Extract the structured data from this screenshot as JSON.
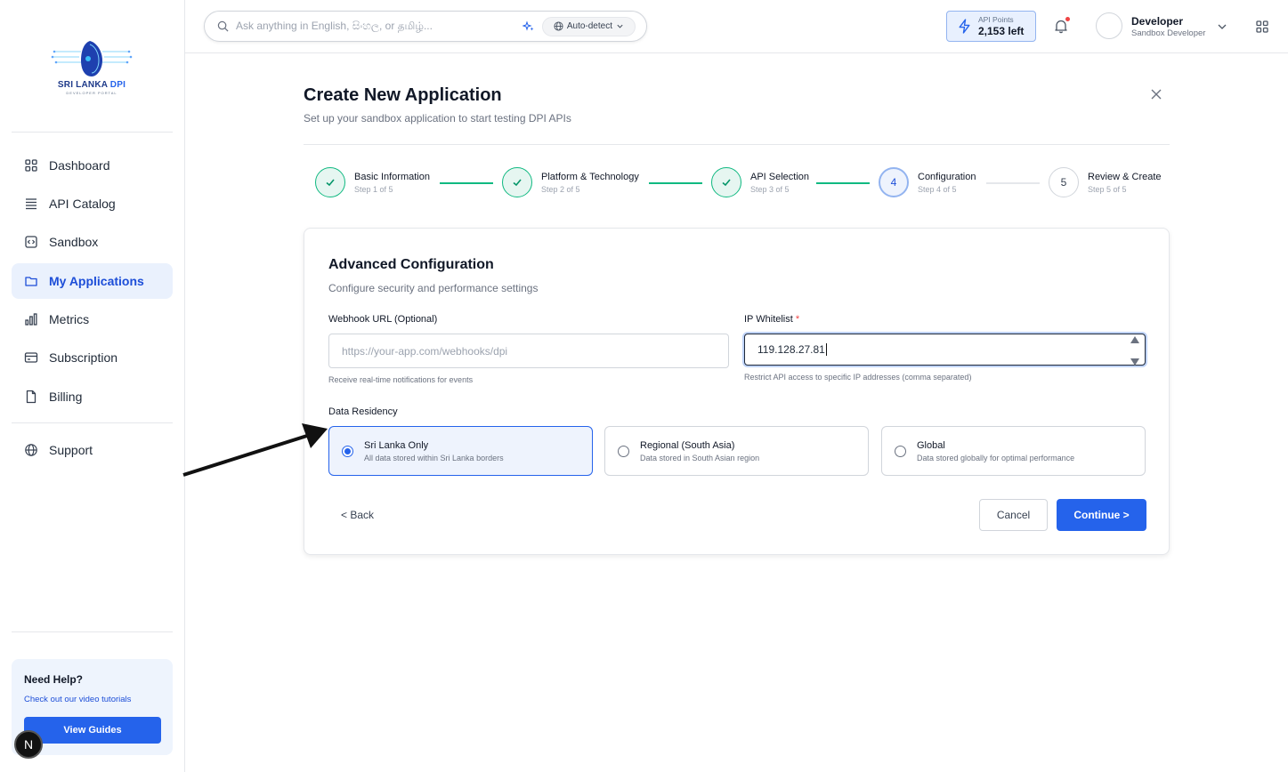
{
  "sidebar": {
    "logo": {
      "line1": "SRI LANKA ",
      "line1_accent": "DPI",
      "line2": "DEVELOPER PORTAL"
    },
    "nav": [
      {
        "label": "Dashboard",
        "icon": "grid-icon"
      },
      {
        "label": "API Catalog",
        "icon": "list-icon"
      },
      {
        "label": "Sandbox",
        "icon": "code-icon"
      },
      {
        "label": "My Applications",
        "icon": "folder-icon",
        "active": true
      },
      {
        "label": "Metrics",
        "icon": "bar-chart-icon"
      },
      {
        "label": "Subscription",
        "icon": "credit-card-icon"
      },
      {
        "label": "Billing",
        "icon": "file-icon"
      },
      {
        "label": "Support",
        "icon": "globe-icon"
      }
    ],
    "help": {
      "title": "Need Help?",
      "subtitle": "Check out our video tutorials",
      "button": "View Guides"
    },
    "badge": "N"
  },
  "topbar": {
    "search_placeholder": "Ask anything in English, සිංහල, or தமிழ்...",
    "language": "Auto-detect",
    "points_label": "API Points",
    "points_value": "2,153 left",
    "user_name": "Developer",
    "user_role": "Sandbox Developer"
  },
  "header": {
    "title": "Create New Application",
    "subtitle": "Set up your sandbox application to start testing DPI APIs"
  },
  "steps": [
    {
      "label": "Basic Information",
      "sub": "Step 1 of 5",
      "state": "done",
      "number": "1"
    },
    {
      "label": "Platform & Technology",
      "sub": "Step 2 of 5",
      "state": "done",
      "number": "2"
    },
    {
      "label": "API Selection",
      "sub": "Step 3 of 5",
      "state": "done",
      "number": "3"
    },
    {
      "label": "Configuration",
      "sub": "Step 4 of 5",
      "state": "current",
      "number": "4"
    },
    {
      "label": "Review & Create",
      "sub": "Step 5 of 5",
      "state": "todo",
      "number": "5"
    }
  ],
  "form": {
    "title": "Advanced Configuration",
    "subtitle": "Configure security and performance settings",
    "webhook": {
      "label": "Webhook URL (Optional)",
      "placeholder": "https://your-app.com/webhooks/dpi",
      "help": "Receive real-time notifications for events"
    },
    "ip": {
      "label": "IP Whitelist",
      "required": "*",
      "value": "119.128.27.81",
      "help": "Restrict API access to specific IP addresses (comma separated)"
    },
    "residency": {
      "label": "Data Residency",
      "options": [
        {
          "title": "Sri Lanka Only",
          "sub": "All data stored within Sri Lanka borders",
          "selected": true
        },
        {
          "title": "Regional (South Asia)",
          "sub": "Data stored in South Asian region",
          "selected": false
        },
        {
          "title": "Global",
          "sub": "Data stored globally for optimal performance",
          "selected": false
        }
      ]
    },
    "back": "< Back",
    "cancel": "Cancel",
    "continue": "Continue >"
  },
  "colors": {
    "primary": "#2563eb",
    "success": "#10b981",
    "active_bg": "#eaf1fd"
  }
}
